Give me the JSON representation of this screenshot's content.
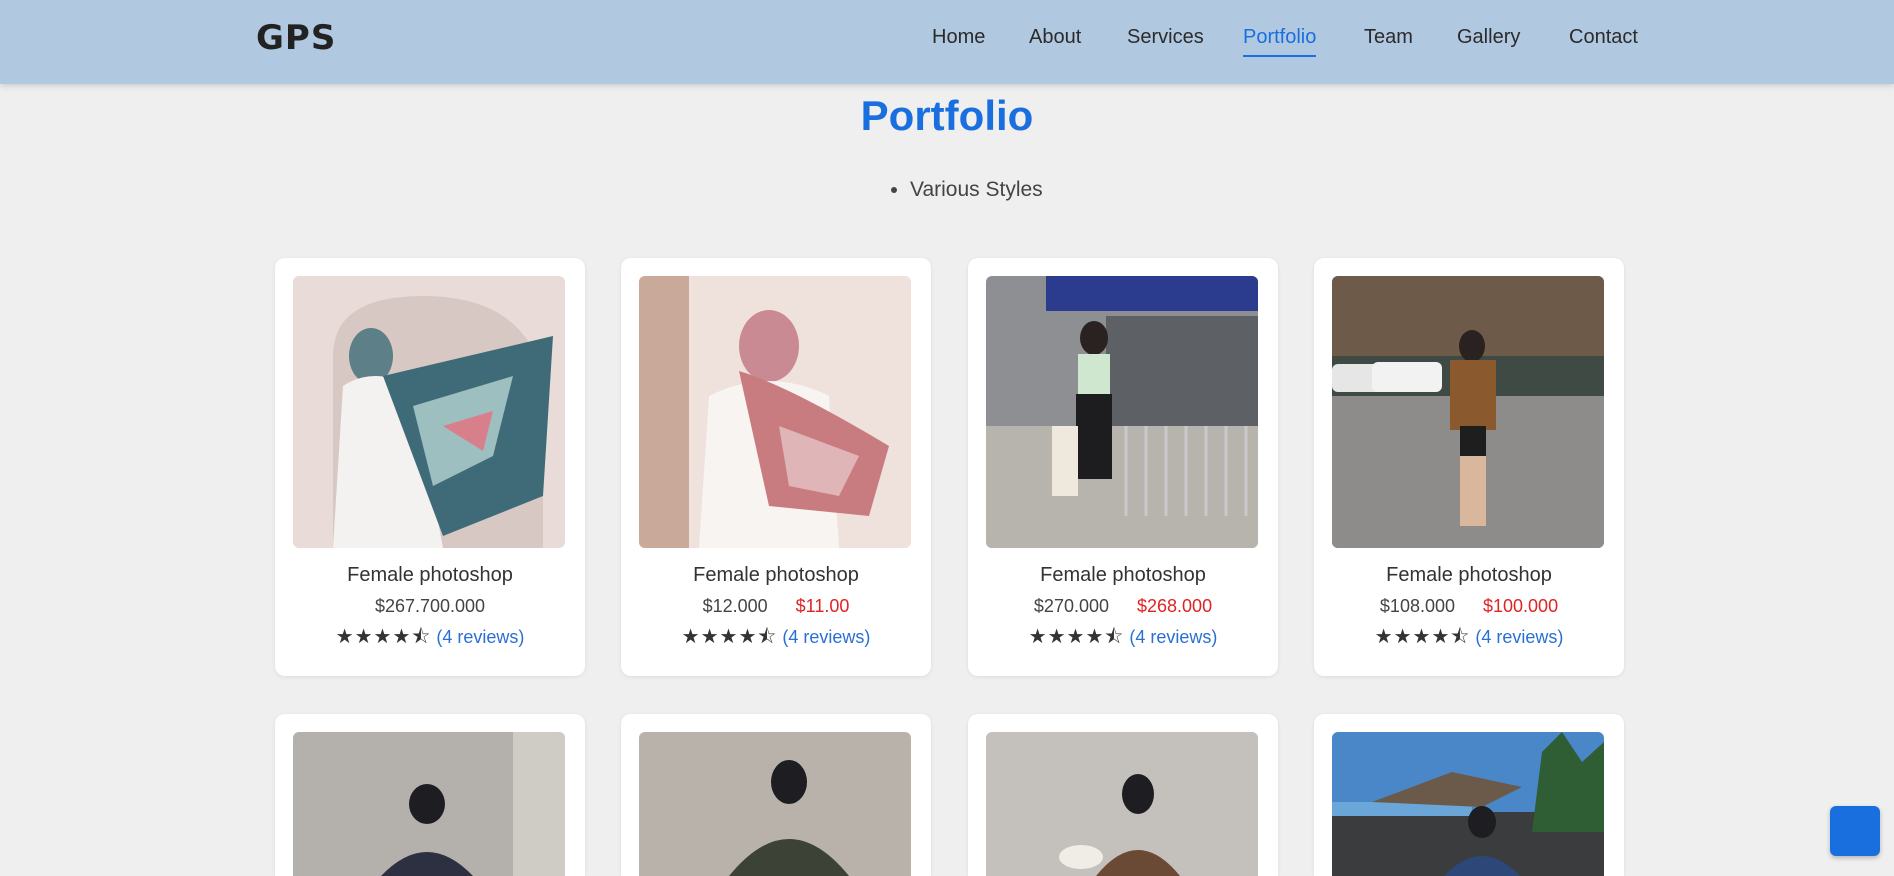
{
  "navbar": {
    "logo": "GPS",
    "links": [
      "Home",
      "About",
      "Services",
      "Portfolio",
      "Team",
      "Gallery",
      "Contact"
    ],
    "active_index": 3
  },
  "section": {
    "title": "Portfolio",
    "bullets": [
      "Various Styles"
    ]
  },
  "products": [
    {
      "title": "Female photoshop",
      "price": "$267.700.000",
      "sale": "",
      "rating": 4.5,
      "reviews": "(4 reviews)"
    },
    {
      "title": "Female photoshop",
      "price": "$12.000",
      "sale": "$11.00",
      "rating": 4.5,
      "reviews": "(4 reviews)"
    },
    {
      "title": "Female photoshop",
      "price": "$270.000",
      "sale": "$268.000",
      "rating": 4.5,
      "reviews": "(4 reviews)"
    },
    {
      "title": "Female photoshop",
      "price": "$108.000",
      "sale": "$100.000",
      "rating": 4.5,
      "reviews": "(4 reviews)"
    }
  ],
  "colors": {
    "navbar_bg": "#b1c8e1",
    "accent": "#1a6fdf",
    "sale": "#e02424",
    "page_bg": "#efefef"
  },
  "icons": {
    "star_full": "★",
    "star_half": "⯪"
  },
  "fab": {
    "icon": "scroll-top-icon"
  }
}
